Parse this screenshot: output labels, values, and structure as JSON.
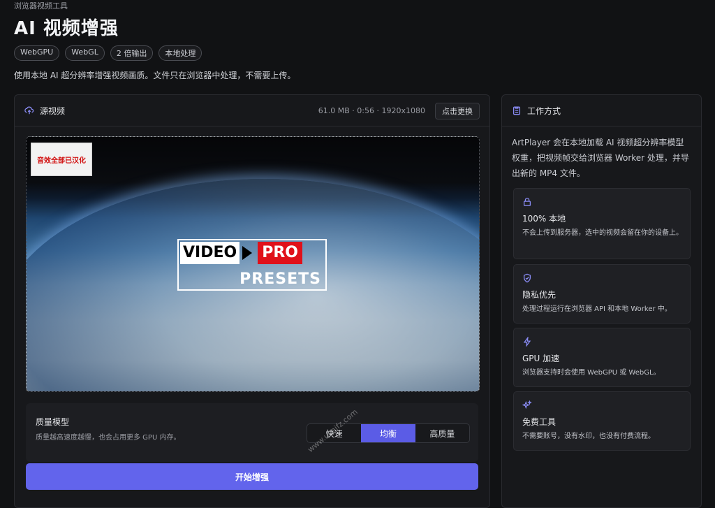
{
  "header": {
    "breadcrumb": "浏览器视频工具",
    "title": "AI 视频增强",
    "tags": [
      "WebGPU",
      "WebGL",
      "2 倍输出",
      "本地处理"
    ],
    "description": "使用本地 AI 超分辨率增强视频画质。文件只在浏览器中处理，不需要上传。"
  },
  "source": {
    "title": "源视频",
    "meta": "61.0 MB · 0:56 · 1920x1080",
    "replace_label": "点击更换",
    "video": {
      "corner_badge": "音效全部已汉化",
      "logo_video": "VIDEO",
      "logo_pro": "PRO",
      "logo_presets": "PRESETS"
    }
  },
  "quality": {
    "title": "质量模型",
    "hint": "质量越高速度越慢，也会占用更多 GPU 内存。",
    "options": [
      "快速",
      "均衡",
      "高质量"
    ],
    "selected": "均衡"
  },
  "start_label": "开始增强",
  "watermark": "www.ucaifz.com",
  "how": {
    "title": "工作方式",
    "intro": "ArtPlayer 会在本地加载 AI 视频超分辨率模型权重，把视频帧交给浏览器 Worker 处理，并导出新的 MP4 文件。",
    "cards": [
      {
        "icon": "lock-icon",
        "title": "100% 本地",
        "desc": "不会上传到服务器，选中的视频会留在你的设备上。"
      },
      {
        "icon": "shield-icon",
        "title": "隐私优先",
        "desc": "处理过程运行在浏览器 API 和本地 Worker 中。"
      },
      {
        "icon": "lightning-icon",
        "title": "GPU 加速",
        "desc": "浏览器支持时会使用 WebGPU 或 WebGL。"
      },
      {
        "icon": "sparkle-icon",
        "title": "免费工具",
        "desc": "不需要账号，没有水印，也没有付费流程。"
      }
    ]
  },
  "colors": {
    "accent": "#6264ec",
    "background": "#111214",
    "panel": "#17181b"
  }
}
